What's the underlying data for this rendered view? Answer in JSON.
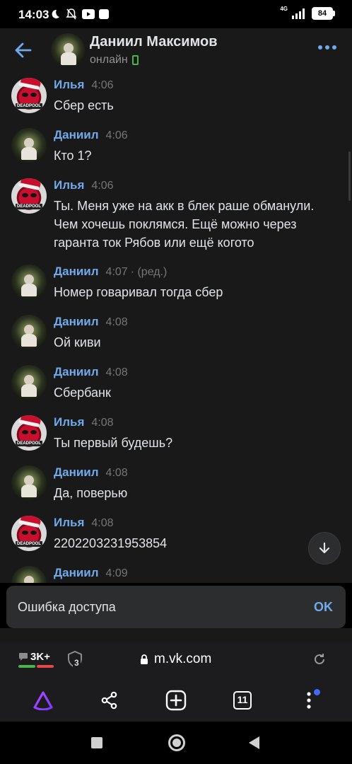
{
  "status_bar": {
    "time": "14:03",
    "network": "4G",
    "battery": "84"
  },
  "header": {
    "contact_name": "Даниил Максимов",
    "presence": "онлайн"
  },
  "messages": [
    {
      "author": "Илья",
      "time": "4:06",
      "edited": "",
      "text": "Сбер есть",
      "avatar": "deadpool-santa"
    },
    {
      "author": "Даниил",
      "time": "4:06",
      "edited": "",
      "text": "Кто 1?",
      "avatar": "daniil-photo"
    },
    {
      "author": "Илья",
      "time": "4:06",
      "edited": "",
      "text": "Ты. Меня уже на акк в блек раше обманули. Чем хочешь поклямся. Ещё можно через гаранта ток Рябов или ещё когото",
      "avatar": "deadpool-santa"
    },
    {
      "author": "Даниил",
      "time": "4:07",
      "edited": "· (ред.)",
      "text": "Номер говаривал тогда сбер",
      "avatar": "daniil-photo"
    },
    {
      "author": "Даниил",
      "time": "4:08",
      "edited": "",
      "text": "Ой киви",
      "avatar": "daniil-photo"
    },
    {
      "author": "Даниил",
      "time": "4:08",
      "edited": "",
      "text": "Сбербанк",
      "avatar": "daniil-photo"
    },
    {
      "author": "Илья",
      "time": "4:08",
      "edited": "",
      "text": "Ты первый будешь?",
      "avatar": "deadpool-santa"
    },
    {
      "author": "Даниил",
      "time": "4:08",
      "edited": "",
      "text": "Да, поверью",
      "avatar": "daniil-photo"
    },
    {
      "author": "Илья",
      "time": "4:08",
      "edited": "",
      "text": "2202203231953854",
      "avatar": "deadpool-santa"
    },
    {
      "author": "Даниил",
      "time": "4:09",
      "edited": "",
      "text": "",
      "avatar": "daniil-photo"
    }
  ],
  "toast": {
    "message": "Ошибка доступа",
    "action": "OK"
  },
  "browser": {
    "comments_badge": "3K+",
    "shield_count": "3",
    "url": "m.vk.com",
    "tabs_count": "11"
  },
  "colors": {
    "accent": "#71aaeb",
    "background": "#19191a",
    "online": "#4bb34b"
  }
}
